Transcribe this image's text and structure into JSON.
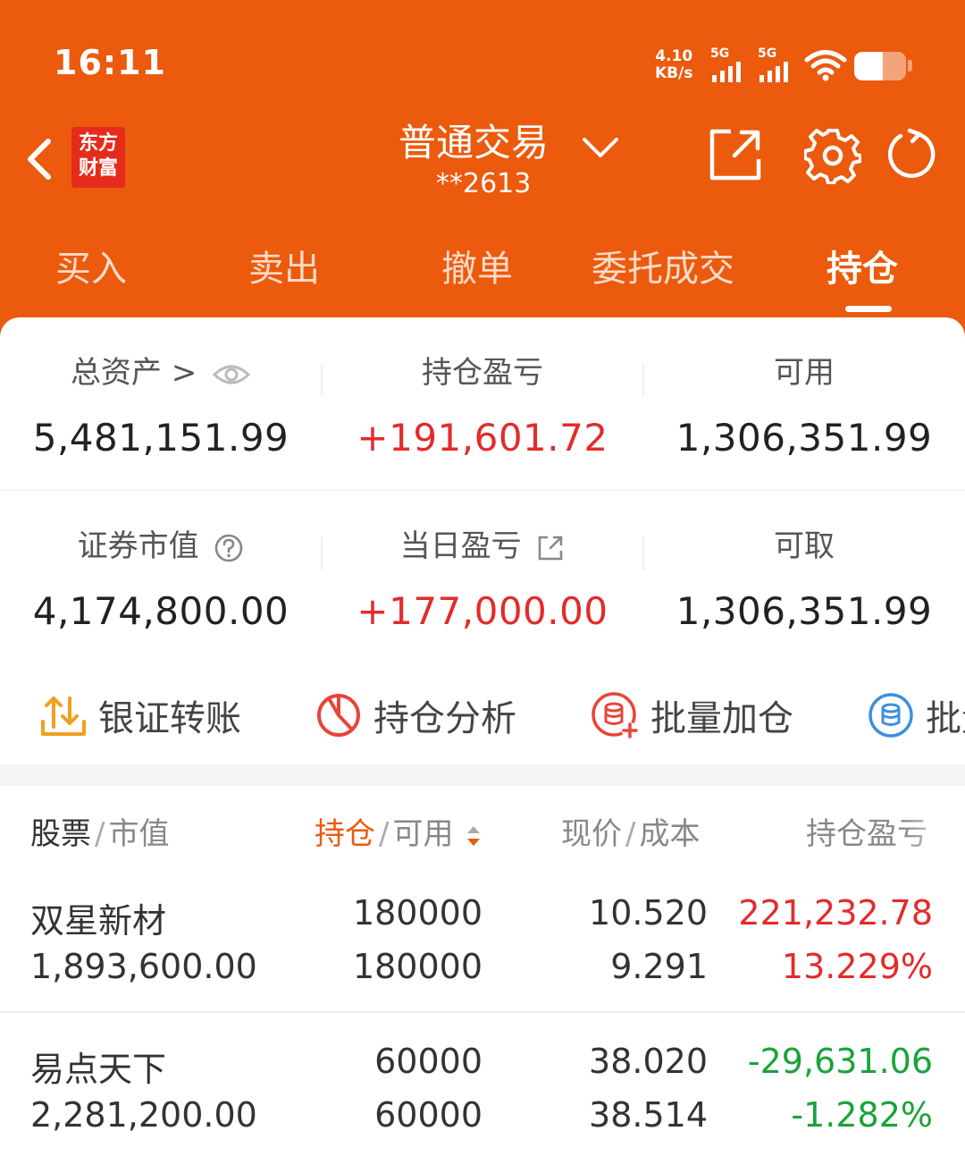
{
  "status_bar": {
    "time": "16:11",
    "net_speed_value": "4.10",
    "net_speed_unit": "KB/s",
    "signal1_label": "5G",
    "signal2_label": "5G",
    "battery_level": 0.55
  },
  "header": {
    "logo_line1": "东方",
    "logo_line2": "财富",
    "title": "普通交易",
    "account": "**2613"
  },
  "tabs": [
    {
      "label": "买入"
    },
    {
      "label": "卖出"
    },
    {
      "label": "撤单"
    },
    {
      "label": "委托成交"
    },
    {
      "label": "持仓"
    }
  ],
  "summary": {
    "total_assets_label": "总资产 >",
    "total_assets_value": "5,481,151.99",
    "position_pl_label": "持仓盈亏",
    "position_pl_value": "+191,601.72",
    "available_label": "可用",
    "available_value": "1,306,351.99",
    "market_value_label": "证券市值",
    "market_value_value": "4,174,800.00",
    "daily_pl_label": "当日盈亏",
    "daily_pl_value": "+177,000.00",
    "withdrawable_label": "可取",
    "withdrawable_value": "1,306,351.99"
  },
  "quick_actions": [
    {
      "label": "银证转账"
    },
    {
      "label": "持仓分析"
    },
    {
      "label": "批量加仓"
    },
    {
      "label": "批量"
    }
  ],
  "table": {
    "col1_main": "股票",
    "col1_sub": "市值",
    "col2_main": "持仓",
    "col2_sub": "可用",
    "col3_main": "现价",
    "col3_sub": "成本",
    "col4_main": "持仓盈亏",
    "rows": [
      {
        "name": "双星新材",
        "market_value": "1,893,600.00",
        "position": "180000",
        "available": "180000",
        "price": "10.520",
        "cost": "9.291",
        "pl": "221,232.78",
        "pl_pct": "13.229%"
      },
      {
        "name": "易点天下",
        "market_value": "2,281,200.00",
        "position": "60000",
        "available": "60000",
        "price": "38.020",
        "cost": "38.514",
        "pl": "-29,631.06",
        "pl_pct": "-1.282%"
      }
    ]
  },
  "colors": {
    "brand": "#eb5a0d",
    "up": "#e32b2b",
    "down": "#1aa33a"
  }
}
